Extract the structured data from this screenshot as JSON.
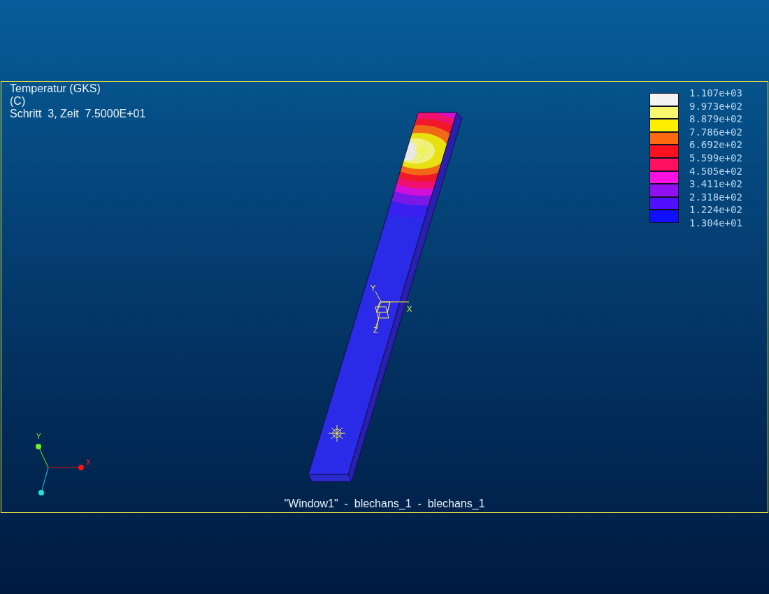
{
  "header": {
    "lines": [
      "Temperatur (GKS)",
      "(C)",
      "Schritt  3, Zeit  7.5000E+01"
    ]
  },
  "legend": {
    "items": [
      {
        "label": "1.107e+03",
        "color": "#f4f4f4"
      },
      {
        "label": "9.973e+02",
        "color": "#f8f870"
      },
      {
        "label": "8.879e+02",
        "color": "#ffee00"
      },
      {
        "label": "7.786e+02",
        "color": "#ff6a10"
      },
      {
        "label": "6.692e+02",
        "color": "#ff1020"
      },
      {
        "label": "5.599e+02",
        "color": "#ff1060"
      },
      {
        "label": "4.505e+02",
        "color": "#ff10e0"
      },
      {
        "label": "3.411e+02",
        "color": "#9010f0"
      },
      {
        "label": "2.318e+02",
        "color": "#5010ff"
      },
      {
        "label": "1.224e+02",
        "color": "#1010ff"
      },
      {
        "label": "1.304e+01"
      }
    ]
  },
  "local_triad": {
    "x_label": "X",
    "y_label": "Y",
    "z_label": "Z"
  },
  "global_triad": {
    "x_label": "X",
    "y_label": "Y"
  },
  "footer": "\"Window1\"  -  blechans_1  -  blechans_1"
}
